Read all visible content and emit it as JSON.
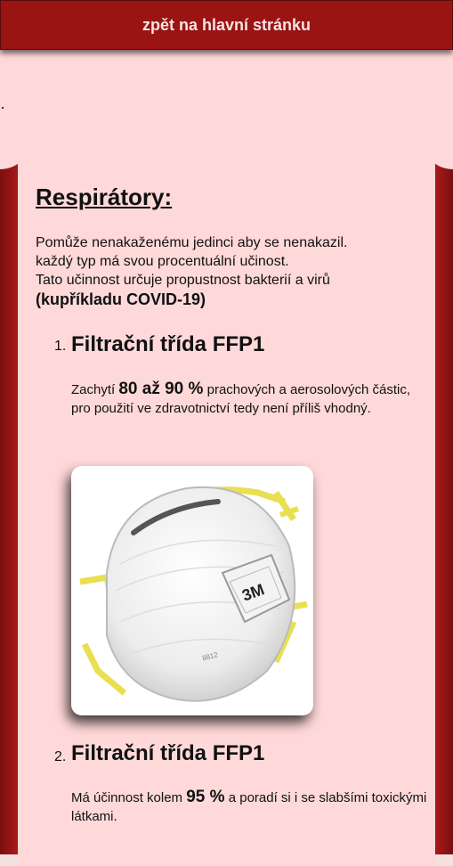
{
  "nav": {
    "back_label": "zpět na hlavní stránku"
  },
  "article": {
    "heading": "Respirátory:",
    "intro_lines": [
      "Pomůže nenakaženému jedinci aby se nenakazil.",
      "každý typ má svou procentuální učinost.",
      "Tato učinnost určuje propustnost bakterií a virů"
    ],
    "intro_bold": "(kupříkladu COVID-19)",
    "items": [
      {
        "number": "1.",
        "title": "Filtrační třída FFP1",
        "desc_before": "Zachytí ",
        "desc_highlight": "80 až 90 %",
        "desc_after": " prachových a aerosolových částic, pro použití ve zdravotnictví tedy není příliš vhodný.",
        "image": {
          "brand_text": "3M",
          "model_text": "8812"
        }
      },
      {
        "number": "2.",
        "title": "Filtrační třída FFP1",
        "desc_before": "Má účinnost kolem ",
        "desc_highlight": "95 %",
        "desc_after": " a poradí si i se slabšími toxickými látkami."
      }
    ]
  }
}
